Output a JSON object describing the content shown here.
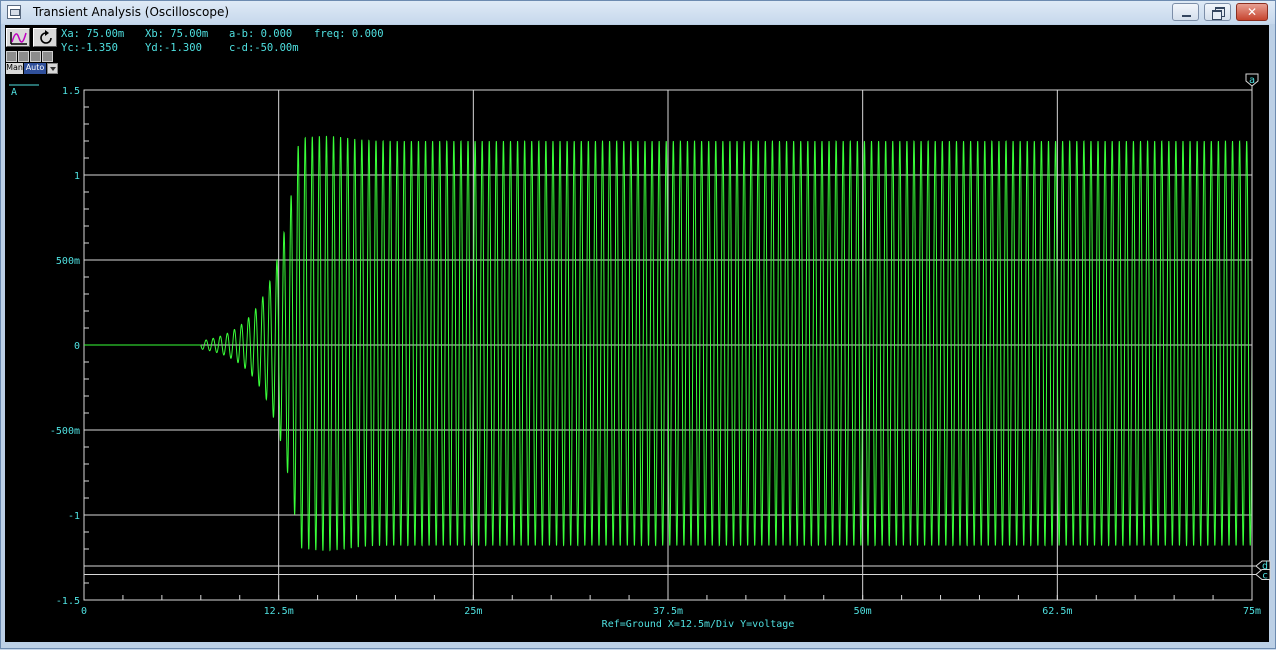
{
  "window": {
    "title": "Transient Analysis (Oscilloscope)"
  },
  "toolbar": {
    "graph_icon": "graph-icon",
    "reset_icon": "reset-icon",
    "man_label": "Man",
    "auto_label": "Auto"
  },
  "readouts": {
    "xa": "Xa: 75.00m",
    "xb": "Xb: 75.00m",
    "a_b": "a-b: 0.000",
    "freq": "freq: 0.000",
    "yc": "Yc:-1.350",
    "yd": "Yd:-1.300",
    "c_d": "c-d:-50.00m"
  },
  "colors": {
    "trace": "#39ff39",
    "grid": "#d8d8d8",
    "text": "#4fe0e0",
    "background": "#000000"
  },
  "chart_data": {
    "type": "line",
    "trace_label": "A",
    "x_unit": "s",
    "xlim": [
      0,
      0.075
    ],
    "ylim": [
      -1.5,
      1.5
    ],
    "x_ticks": [
      {
        "value": 0,
        "label": "0"
      },
      {
        "value": 0.0125,
        "label": "12.5m"
      },
      {
        "value": 0.025,
        "label": "25m"
      },
      {
        "value": 0.0375,
        "label": "37.5m"
      },
      {
        "value": 0.05,
        "label": "50m"
      },
      {
        "value": 0.0625,
        "label": "62.5m"
      },
      {
        "value": 0.075,
        "label": "75m"
      }
    ],
    "y_ticks": [
      {
        "value": 1.5,
        "label": "1.5"
      },
      {
        "value": 1,
        "label": "1"
      },
      {
        "value": 0.5,
        "label": "500m"
      },
      {
        "value": 0,
        "label": "0"
      },
      {
        "value": -0.5,
        "label": "-500m"
      },
      {
        "value": -1,
        "label": "-1"
      },
      {
        "value": -1.5,
        "label": "-1.5"
      }
    ],
    "footer": "Ref=Ground  X=12.5m/Div Y=voltage",
    "signal": {
      "frequency_hz": 2200,
      "onset_s": 0.0075,
      "peak_positive": 1.2,
      "peak_negative": -1.18,
      "growth_tau_s": 0.0025,
      "overshoot_peak": 1.23,
      "overshoot_time_s": 0.0155
    },
    "cursors": {
      "a": {
        "x": 0.075
      },
      "b": {
        "x": 0.075
      },
      "c": {
        "y": -1.35
      },
      "d": {
        "y": -1.3
      }
    },
    "cursor_labels": {
      "a": "a",
      "c": "c",
      "d": "d"
    }
  }
}
